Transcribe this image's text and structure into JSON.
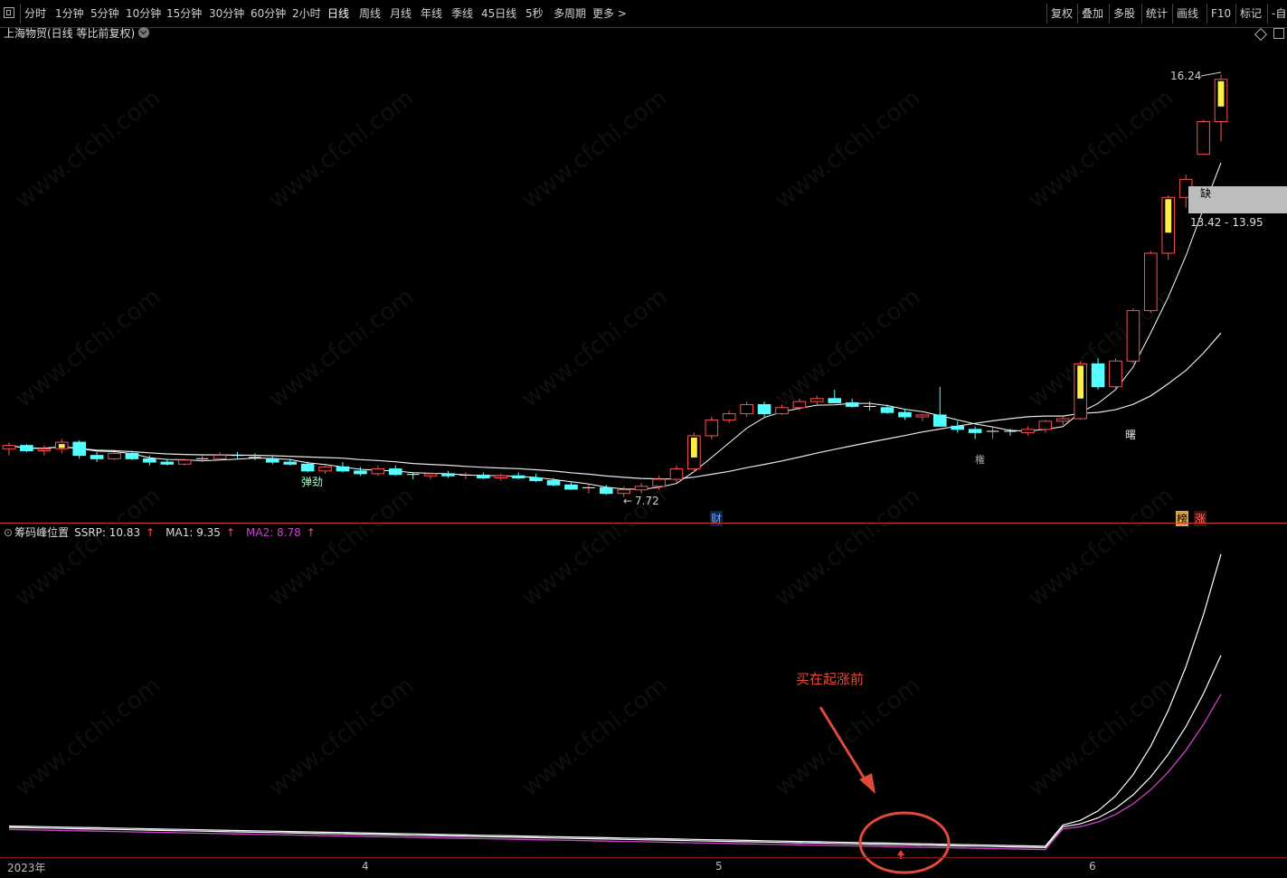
{
  "toolbar": {
    "periods": [
      "分时",
      "1分钟",
      "5分钟",
      "10分钟",
      "15分钟",
      "30分钟",
      "60分钟",
      "2小时",
      "日线",
      "周线",
      "月线",
      "年线",
      "季线",
      "45日线",
      "5秒",
      "多周期",
      "更多 >"
    ],
    "active": "日线",
    "right_buttons": [
      "复权",
      "叠加",
      "多股",
      "统计",
      "画线",
      "F10",
      "标记",
      "-自选"
    ]
  },
  "main": {
    "title": "上海物贸(日线 等比前复权)",
    "max_label": "16.24",
    "min_label": "7.72",
    "gap_label": "缺",
    "gap_range": "13.42 - 13.95",
    "markers": {
      "m1": "弹劲",
      "m2": "财",
      "m3": "曙",
      "m4": "榜",
      "m5": "涨",
      "m6": "権"
    }
  },
  "indicator": {
    "name": "筹码峰位置",
    "ssrp_label": "SSRP: 10.83",
    "ma1_label": "MA1: 9.35",
    "ma2_label": "MA2: 8.78",
    "annotation": "买在起涨前"
  },
  "axis": {
    "year": "2023年",
    "m4": "4",
    "m5": "5",
    "m6": "6"
  },
  "colors": {
    "up": "#ff5050",
    "down": "#54ffff",
    "ma": "#ffffff",
    "ssrp": "#ffffff",
    "ma1": "#ffffff",
    "ma2": "#cc44cc",
    "divider": "#c0392b",
    "annot": "#e04a3a"
  },
  "watermark": "www.cfchi.com",
  "chart_data": {
    "type": "candlestick",
    "title": "上海物贸(日线 等比前复权)",
    "annotations": [
      "16.24",
      "7.72",
      "13.42 - 13.95"
    ],
    "candles": [
      [
        7.95,
        8.05,
        7.85,
        8.0
      ],
      [
        8.0,
        8.02,
        7.9,
        7.92
      ],
      [
        7.92,
        8.0,
        7.85,
        7.95
      ],
      [
        7.95,
        8.1,
        7.88,
        8.05
      ],
      [
        8.05,
        8.08,
        7.8,
        7.85
      ],
      [
        7.85,
        7.9,
        7.75,
        7.8
      ],
      [
        7.8,
        7.9,
        7.78,
        7.88
      ],
      [
        7.88,
        7.92,
        7.78,
        7.8
      ],
      [
        7.8,
        7.85,
        7.7,
        7.75
      ],
      [
        7.75,
        7.8,
        7.7,
        7.72
      ],
      [
        7.72,
        7.8,
        7.7,
        7.78
      ],
      [
        7.78,
        7.85,
        7.75,
        7.8
      ],
      [
        7.8,
        7.9,
        7.78,
        7.85
      ],
      [
        7.85,
        7.9,
        7.8,
        7.82
      ],
      [
        7.82,
        7.88,
        7.78,
        7.8
      ],
      [
        7.8,
        7.84,
        7.72,
        7.75
      ],
      [
        7.75,
        7.8,
        7.7,
        7.72
      ],
      [
        7.72,
        7.76,
        7.6,
        7.62
      ],
      [
        7.62,
        7.7,
        7.58,
        7.68
      ],
      [
        7.68,
        7.75,
        7.6,
        7.62
      ],
      [
        7.62,
        7.68,
        7.55,
        7.58
      ],
      [
        7.58,
        7.7,
        7.55,
        7.65
      ],
      [
        7.65,
        7.7,
        7.55,
        7.57
      ],
      [
        7.57,
        7.6,
        7.5,
        7.55
      ],
      [
        7.55,
        7.6,
        7.5,
        7.58
      ],
      [
        7.58,
        7.62,
        7.52,
        7.55
      ],
      [
        7.55,
        7.6,
        7.5,
        7.56
      ],
      [
        7.56,
        7.6,
        7.5,
        7.52
      ],
      [
        7.52,
        7.58,
        7.48,
        7.55
      ],
      [
        7.55,
        7.6,
        7.5,
        7.52
      ],
      [
        7.52,
        7.58,
        7.46,
        7.48
      ],
      [
        7.48,
        7.52,
        7.4,
        7.42
      ],
      [
        7.42,
        7.46,
        7.35,
        7.36
      ],
      [
        7.36,
        7.42,
        7.3,
        7.38
      ],
      [
        7.38,
        7.42,
        7.28,
        7.3
      ],
      [
        7.3,
        7.4,
        7.25,
        7.35
      ],
      [
        7.35,
        7.45,
        7.3,
        7.4
      ],
      [
        7.4,
        7.55,
        7.35,
        7.5
      ],
      [
        7.5,
        7.7,
        7.45,
        7.65
      ],
      [
        7.65,
        8.2,
        7.6,
        8.15
      ],
      [
        8.15,
        8.45,
        8.1,
        8.4
      ],
      [
        8.4,
        8.55,
        8.35,
        8.5
      ],
      [
        8.5,
        8.7,
        8.45,
        8.65
      ],
      [
        8.65,
        8.7,
        8.45,
        8.5
      ],
      [
        8.5,
        8.65,
        8.48,
        8.6
      ],
      [
        8.6,
        8.75,
        8.55,
        8.7
      ],
      [
        8.7,
        8.8,
        8.65,
        8.75
      ],
      [
        8.75,
        8.9,
        8.7,
        8.68
      ],
      [
        8.68,
        8.75,
        8.6,
        8.62
      ],
      [
        8.62,
        8.7,
        8.55,
        8.6
      ],
      [
        8.6,
        8.65,
        8.5,
        8.52
      ],
      [
        8.52,
        8.58,
        8.4,
        8.45
      ],
      [
        8.45,
        8.5,
        8.38,
        8.48
      ],
      [
        8.48,
        8.95,
        8.4,
        8.3
      ],
      [
        8.3,
        8.38,
        8.2,
        8.25
      ],
      [
        8.25,
        8.3,
        8.1,
        8.2
      ],
      [
        8.2,
        8.28,
        8.1,
        8.22
      ],
      [
        8.22,
        8.26,
        8.15,
        8.2
      ],
      [
        8.2,
        8.3,
        8.15,
        8.25
      ],
      [
        8.25,
        8.4,
        8.2,
        8.38
      ],
      [
        8.38,
        8.45,
        8.32,
        8.42
      ],
      [
        8.42,
        9.4,
        8.4,
        9.35
      ],
      [
        9.35,
        9.45,
        8.9,
        8.95
      ],
      [
        8.95,
        9.45,
        8.9,
        9.4
      ],
      [
        9.4,
        10.4,
        9.35,
        10.35
      ],
      [
        10.35,
        11.6,
        10.3,
        11.55
      ],
      [
        11.55,
        12.9,
        11.4,
        12.85
      ],
      [
        12.85,
        13.42,
        12.6,
        13.3
      ],
      [
        13.95,
        14.9,
        13.95,
        14.85
      ],
      [
        14.85,
        16.24,
        14.3,
        16.1
      ]
    ]
  }
}
